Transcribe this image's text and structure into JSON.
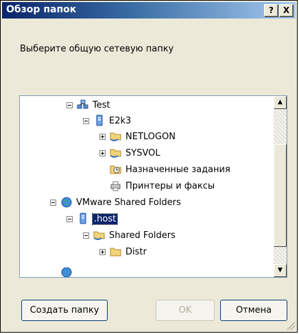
{
  "window": {
    "title": "Обзор папок",
    "help_button": "?",
    "close_button": "X"
  },
  "prompt": "Выберите общую сетевую папку",
  "tree": {
    "nodes": [
      {
        "label": "Test",
        "icon": "network-domain-icon",
        "expander": "minus"
      },
      {
        "label": "E2k3",
        "icon": "computer-icon",
        "expander": "minus"
      },
      {
        "label": "NETLOGON",
        "icon": "shared-folder-icon",
        "expander": "plus"
      },
      {
        "label": "SYSVOL",
        "icon": "shared-folder-icon",
        "expander": "plus"
      },
      {
        "label": "Назначенные задания",
        "icon": "scheduled-tasks-icon",
        "expander": "none"
      },
      {
        "label": "Принтеры и факсы",
        "icon": "printers-icon",
        "expander": "none"
      },
      {
        "label": "VMware Shared Folders",
        "icon": "network-icon",
        "expander": "minus"
      },
      {
        "label": ".host",
        "icon": "computer-icon",
        "expander": "minus",
        "selected": true
      },
      {
        "label": "Shared Folders",
        "icon": "shared-folder-icon",
        "expander": "minus"
      },
      {
        "label": "Distr",
        "icon": "folder-icon",
        "expander": "plus"
      }
    ]
  },
  "buttons": {
    "new_folder": "Создать папку",
    "ok": "OK",
    "cancel": "Отмена"
  },
  "colors": {
    "title_start": "#0a246a",
    "title_end": "#a6caf0",
    "selection": "#0a246a",
    "dialog_bg": "#ece9d8"
  }
}
